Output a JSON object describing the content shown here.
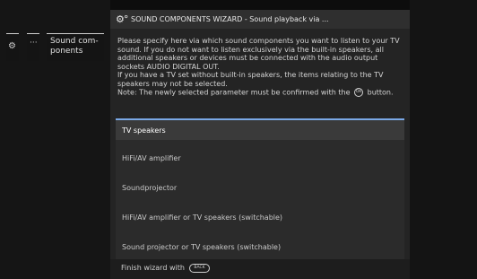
{
  "breadcrumb": {
    "gear_icon": "gear-icon",
    "ellipsis": "···",
    "current_label": "Sound com-\nponents"
  },
  "dialog": {
    "title_icon": "wizard-gears-icon",
    "title": "SOUND COMPONENTS WIZARD - Sound playback via ...",
    "description": {
      "p1": "Please specify here via which sound components you want to listen to your TV sound. If you do not want to listen exclusively via the built-in speakers, all additional speakers or devices must be connected with the audio output sockets AUDIO DIGITAL OUT.",
      "p2": "If you have a TV set without built-in speakers, the items relating to the TV speakers may not be selected.",
      "p3_prefix": "Note: The newly selected parameter must be confirmed with the",
      "ok_label": "OK",
      "p3_suffix": "button."
    },
    "options": [
      {
        "label": "TV speakers",
        "selected": true
      },
      {
        "label": "HiFi/AV amplifier",
        "selected": false
      },
      {
        "label": "Soundprojector",
        "selected": false
      },
      {
        "label": "HiFi/AV amplifier or TV speakers (switchable)",
        "selected": false
      },
      {
        "label": "Sound projector or TV speakers (switchable)",
        "selected": false
      }
    ],
    "footer": {
      "finish_label": "Finish wizard with",
      "back_key_label": "BACK"
    }
  },
  "colors": {
    "background": "#0d0d0d",
    "dialog_bg": "#242424",
    "selection_accent": "#7aa8e6"
  }
}
